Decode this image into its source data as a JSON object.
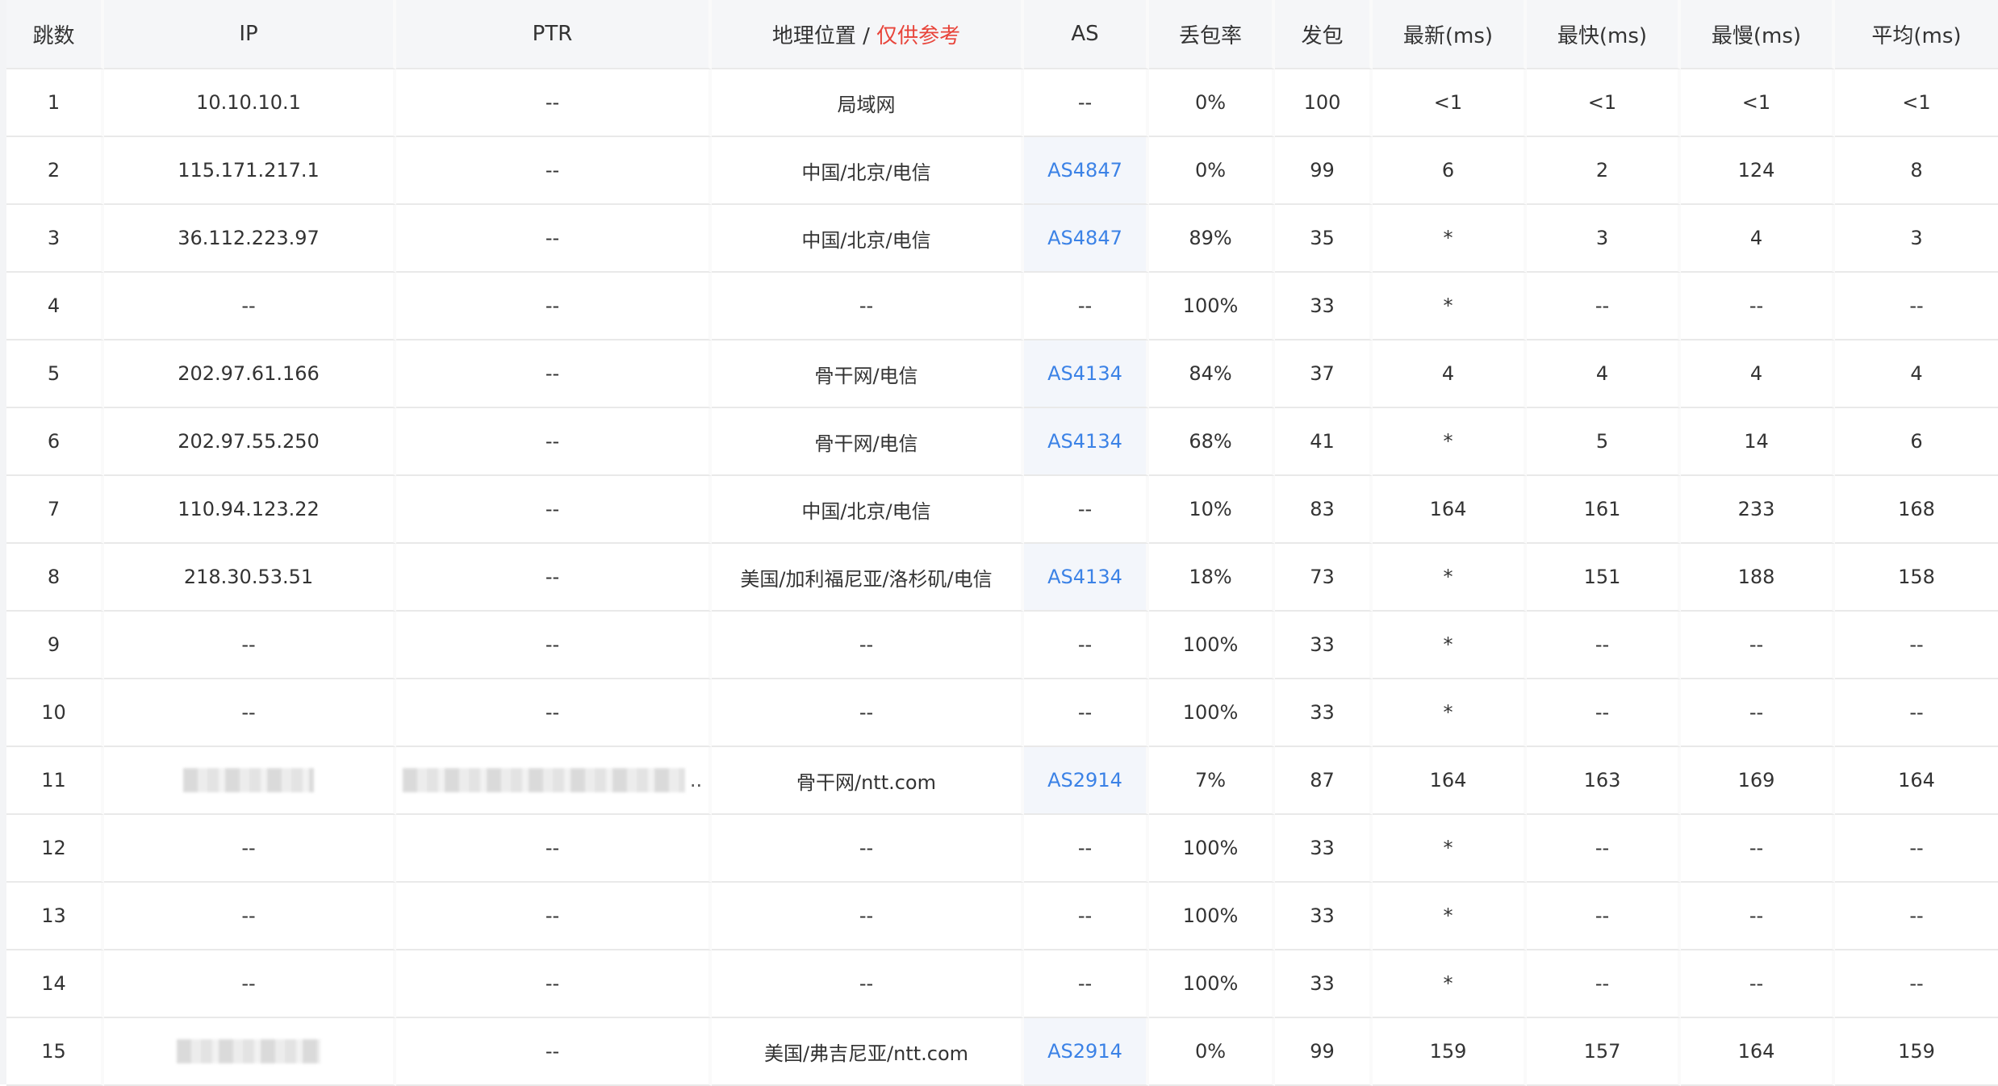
{
  "columns": [
    {
      "key": "hop",
      "label": "跳数"
    },
    {
      "key": "ip",
      "label": "IP"
    },
    {
      "key": "ptr",
      "label": "PTR"
    },
    {
      "key": "geo",
      "label": "地理位置 / ",
      "label_note": "仅供参考"
    },
    {
      "key": "as",
      "label": "AS"
    },
    {
      "key": "loss",
      "label": "丢包率"
    },
    {
      "key": "sent",
      "label": "发包"
    },
    {
      "key": "last",
      "label": "最新(ms)"
    },
    {
      "key": "best",
      "label": "最快(ms)"
    },
    {
      "key": "worst",
      "label": "最慢(ms)"
    },
    {
      "key": "avg",
      "label": "平均(ms)"
    }
  ],
  "rows": [
    {
      "hop": "1",
      "ip": "10.10.10.1",
      "ptr": "--",
      "geo": "局域网",
      "as": "--",
      "loss": "0%",
      "sent": "100",
      "last": "<1",
      "best": "<1",
      "worst": "<1",
      "avg": "<1"
    },
    {
      "hop": "2",
      "ip": "115.171.217.1",
      "ptr": "--",
      "geo": "中国/北京/电信",
      "as": "AS4847",
      "loss": "0%",
      "sent": "99",
      "last": "6",
      "best": "2",
      "worst": "124",
      "avg": "8"
    },
    {
      "hop": "3",
      "ip": "36.112.223.97",
      "ptr": "--",
      "geo": "中国/北京/电信",
      "as": "AS4847",
      "loss": "89%",
      "sent": "35",
      "last": "*",
      "best": "3",
      "worst": "4",
      "avg": "3"
    },
    {
      "hop": "4",
      "ip": "--",
      "ptr": "--",
      "geo": "--",
      "as": "--",
      "loss": "100%",
      "sent": "33",
      "last": "*",
      "best": "--",
      "worst": "--",
      "avg": "--"
    },
    {
      "hop": "5",
      "ip": "202.97.61.166",
      "ptr": "--",
      "geo": "骨干网/电信",
      "as": "AS4134",
      "loss": "84%",
      "sent": "37",
      "last": "4",
      "best": "4",
      "worst": "4",
      "avg": "4"
    },
    {
      "hop": "6",
      "ip": "202.97.55.250",
      "ptr": "--",
      "geo": "骨干网/电信",
      "as": "AS4134",
      "loss": "68%",
      "sent": "41",
      "last": "*",
      "best": "5",
      "worst": "14",
      "avg": "6"
    },
    {
      "hop": "7",
      "ip": "110.94.123.22",
      "ptr": "--",
      "geo": "中国/北京/电信",
      "as": "--",
      "loss": "10%",
      "sent": "83",
      "last": "164",
      "best": "161",
      "worst": "233",
      "avg": "168"
    },
    {
      "hop": "8",
      "ip": "218.30.53.51",
      "ptr": "--",
      "geo": "美国/加利福尼亚/洛杉矶/电信",
      "as": "AS4134",
      "loss": "18%",
      "sent": "73",
      "last": "*",
      "best": "151",
      "worst": "188",
      "avg": "158"
    },
    {
      "hop": "9",
      "ip": "--",
      "ptr": "--",
      "geo": "--",
      "as": "--",
      "loss": "100%",
      "sent": "33",
      "last": "*",
      "best": "--",
      "worst": "--",
      "avg": "--"
    },
    {
      "hop": "10",
      "ip": "--",
      "ptr": "--",
      "geo": "--",
      "as": "--",
      "loss": "100%",
      "sent": "33",
      "last": "*",
      "best": "--",
      "worst": "--",
      "avg": "--"
    },
    {
      "hop": "11",
      "ip": "",
      "ip_redacted": true,
      "ptr": "",
      "ptr_redacted": true,
      "ptr_suffix": "..",
      "geo": "骨干网/ntt.com",
      "as": "AS2914",
      "loss": "7%",
      "sent": "87",
      "last": "164",
      "best": "163",
      "worst": "169",
      "avg": "164"
    },
    {
      "hop": "12",
      "ip": "--",
      "ptr": "--",
      "geo": "--",
      "as": "--",
      "loss": "100%",
      "sent": "33",
      "last": "*",
      "best": "--",
      "worst": "--",
      "avg": "--"
    },
    {
      "hop": "13",
      "ip": "--",
      "ptr": "--",
      "geo": "--",
      "as": "--",
      "loss": "100%",
      "sent": "33",
      "last": "*",
      "best": "--",
      "worst": "--",
      "avg": "--"
    },
    {
      "hop": "14",
      "ip": "--",
      "ptr": "--",
      "geo": "--",
      "as": "--",
      "loss": "100%",
      "sent": "33",
      "last": "*",
      "best": "--",
      "worst": "--",
      "avg": "--"
    },
    {
      "hop": "15",
      "ip": "",
      "ip_redacted": true,
      "ptr": "--",
      "geo": "美国/弗吉尼亚/ntt.com",
      "as": "AS2914",
      "loss": "0%",
      "sent": "99",
      "last": "159",
      "best": "157",
      "worst": "164",
      "avg": "159"
    }
  ],
  "colors": {
    "link": "#3b82e6",
    "note": "#e8443a",
    "header_bg": "#f5f6f8"
  }
}
